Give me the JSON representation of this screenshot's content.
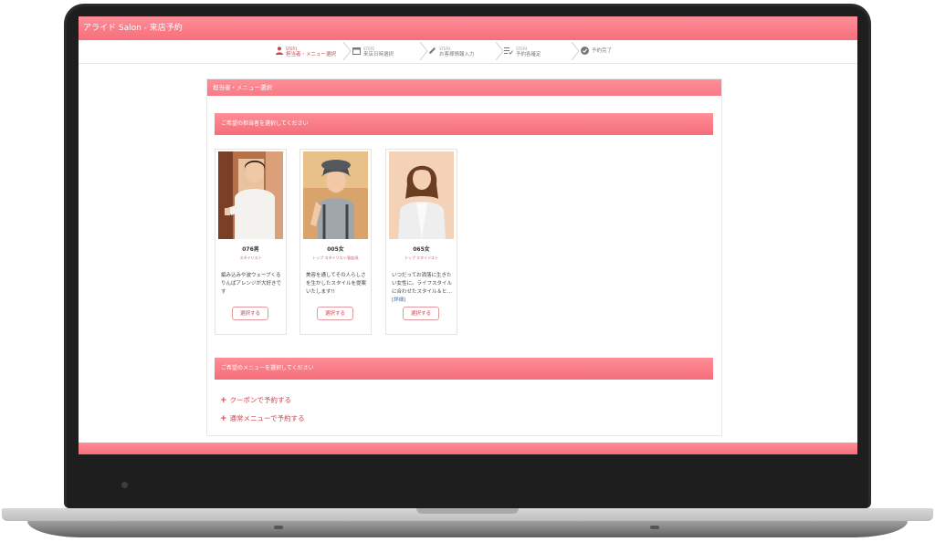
{
  "header": {
    "title": "アライド Salon - 来店予約"
  },
  "steps": [
    {
      "num": "STEP1",
      "label": "担当者・メニュー選択",
      "icon": "person-icon",
      "active": true
    },
    {
      "num": "STEP2",
      "label": "来店日時選択",
      "icon": "calendar-icon",
      "active": false
    },
    {
      "num": "STEP3",
      "label": "お客様情報入力",
      "icon": "pencil-icon",
      "active": false
    },
    {
      "num": "STEP4",
      "label": "予約各確定",
      "icon": "list-check-icon",
      "active": false
    },
    {
      "num": "",
      "label": "予約完了",
      "icon": "check-circle-icon",
      "active": false
    }
  ],
  "panel": {
    "title": "担当者・メニュー選択"
  },
  "staff_section": {
    "title": "ご希望の担当者を選択してください"
  },
  "staff": [
    {
      "name": "076男",
      "role": "スタイリスト",
      "desc": "編み込みや波ウェーブくるりんぱアレンジが大好きです",
      "detail": "",
      "button": "選択する"
    },
    {
      "name": "005女",
      "role": "トップ スタイリスト/副店長",
      "desc": "美容を通してその人らしさを生かしたスタイルを提案いたします!!",
      "detail": "",
      "button": "選択する"
    },
    {
      "name": "065女",
      "role": "トップ スタイリスト",
      "desc": "いつだってお洒落に生きたい女性に。ライフスタイルに合わせたスタイル＆ヒ…",
      "detail": "[詳細]",
      "button": "選択する"
    }
  ],
  "menu_section": {
    "title": "ご希望のメニューを選択してください",
    "links": [
      "クーポンで予約する",
      "通常メニューで予約する"
    ]
  },
  "colors": {
    "accent": "#f56f7b",
    "accent_text": "#c9464f"
  }
}
